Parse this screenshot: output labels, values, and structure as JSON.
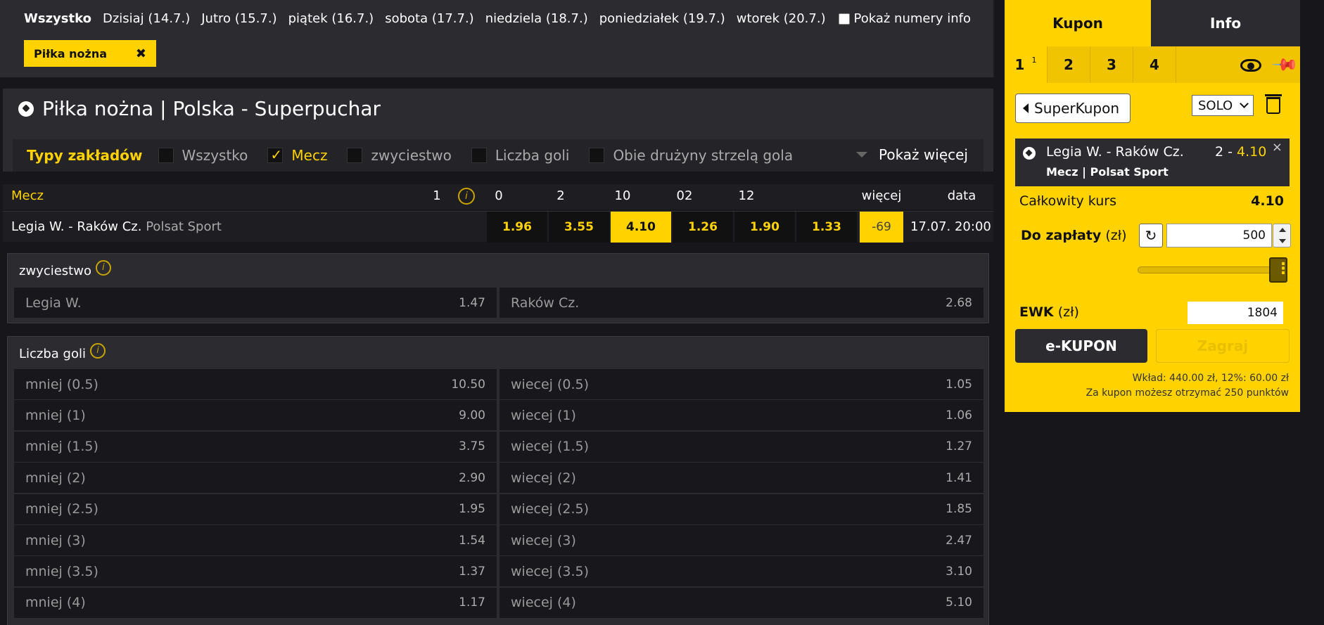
{
  "day_nav": [
    {
      "label": "Wszystko",
      "active": true
    },
    {
      "label": "Dzisiaj (14.7.)"
    },
    {
      "label": "Jutro (15.7.)"
    },
    {
      "label": "piątek (16.7.)"
    },
    {
      "label": "sobota (17.7.)"
    },
    {
      "label": "niedziela (18.7.)"
    },
    {
      "label": "poniedziałek (19.7.)"
    },
    {
      "label": "wtorek (20.7.)"
    }
  ],
  "show_info_label": "Pokaż numery info",
  "filter_chip": {
    "label": "Piłka nożna",
    "close": "✖"
  },
  "section_title": "Piłka nożna | Polska - Superpuchar",
  "bet_types": {
    "label": "Typy zakładów",
    "options": [
      {
        "label": "Wszystko",
        "checked": false
      },
      {
        "label": "Mecz",
        "checked": true
      },
      {
        "label": "zwyciestwo",
        "checked": false
      },
      {
        "label": "Liczba goli",
        "checked": false
      },
      {
        "label": "Obie drużyny strzelą gola",
        "checked": false
      }
    ],
    "show_more": "Pokaż więcej"
  },
  "odds_header": {
    "mecz": "Mecz",
    "info": "i",
    "columns": [
      "1",
      "0",
      "2",
      "10",
      "02",
      "12"
    ],
    "more": "więcej",
    "date": "data"
  },
  "match": {
    "name": "Legia W. - Raków Cz.",
    "tv": "Polsat Sport",
    "odds": [
      "1.96",
      "3.55",
      "4.10",
      "1.26",
      "1.90",
      "1.33"
    ],
    "selected_index": 2,
    "more": "-69",
    "date": "17.07. 20:00"
  },
  "market_winner": {
    "title": "zwyciestwo",
    "info": "i",
    "left": {
      "label": "Legia W.",
      "odd": "1.47"
    },
    "right": {
      "label": "Raków Cz.",
      "odd": "2.68"
    }
  },
  "market_goals": {
    "title": "Liczba goli",
    "info": "i",
    "rows": [
      {
        "l": "mniej (0.5)",
        "lo": "10.50",
        "r": "wiecej (0.5)",
        "ro": "1.05"
      },
      {
        "l": "mniej (1)",
        "lo": "9.00",
        "r": "wiecej (1)",
        "ro": "1.06"
      },
      {
        "l": "mniej (1.5)",
        "lo": "3.75",
        "r": "wiecej (1.5)",
        "ro": "1.27"
      },
      {
        "l": "mniej (2)",
        "lo": "2.90",
        "r": "wiecej (2)",
        "ro": "1.41"
      },
      {
        "l": "mniej (2.5)",
        "lo": "1.95",
        "r": "wiecej (2.5)",
        "ro": "1.85"
      },
      {
        "l": "mniej (3)",
        "lo": "1.54",
        "r": "wiecej (3)",
        "ro": "2.47"
      },
      {
        "l": "mniej (3.5)",
        "lo": "1.37",
        "r": "wiecej (3.5)",
        "ro": "3.10"
      },
      {
        "l": "mniej (4)",
        "lo": "1.17",
        "r": "wiecej (4)",
        "ro": "5.10"
      }
    ]
  },
  "coupon": {
    "tabs": {
      "active": "Kupon",
      "inactive": "Info"
    },
    "numbers": [
      {
        "label": "1",
        "badge": "1"
      },
      {
        "label": "2"
      },
      {
        "label": "3"
      },
      {
        "label": "4"
      }
    ],
    "super_label": "SuperKupon",
    "mode": "SOLO",
    "bet": {
      "match": "Legia W. - Raków Cz.",
      "pick": "2 - ",
      "pick_odd": "4.10",
      "close": "×",
      "sub": "Mecz | Polsat Sport"
    },
    "total_label": "Całkowity kurs",
    "total_value": "4.10",
    "pay_label": "Do zapłaty",
    "pay_unit": "(zł)",
    "refresh": "↻",
    "stake": "500",
    "ewk_label": "EWK",
    "ewk_unit": "(zł)",
    "ewk_value": "1804",
    "ekupon_label": "e-KUPON",
    "zagraj_label": "Zagraj",
    "summary1": "Wkład: 440.00 zł, 12%: 60.00 zł",
    "summary2": "Za kupon możesz otrzymać 250 punktów",
    "colors": {
      "accent": "#ffd200",
      "dark": "#2b2b30"
    }
  }
}
